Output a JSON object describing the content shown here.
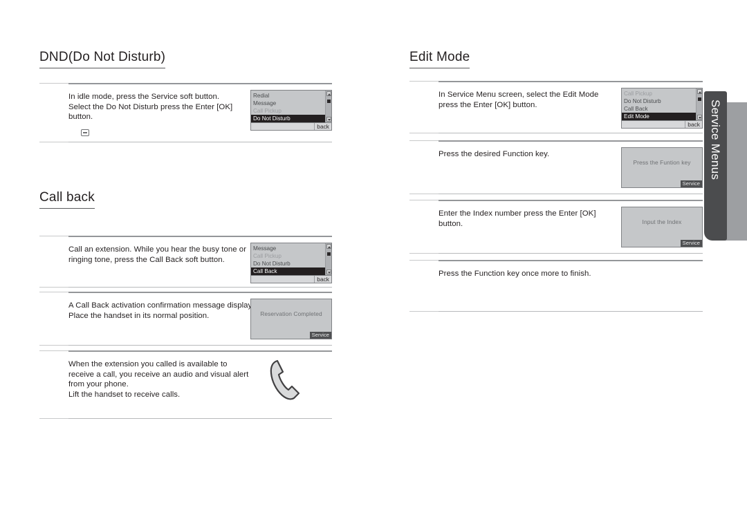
{
  "side_tab": {
    "label": "Service Menus"
  },
  "left_column": {
    "sections": [
      {
        "heading": "DND(Do Not Disturb)",
        "steps": [
          {
            "text": "In idle mode, press the Service  soft button.\nSelect the Do Not Disturb      press the Enter [OK]\nbutton.",
            "key_glyph": "button-key-icon",
            "screen": {
              "type": "list",
              "rows": [
                {
                  "label": "Redial",
                  "state": "normal"
                },
                {
                  "label": "Message",
                  "state": "normal"
                },
                {
                  "label": "Call Pickup",
                  "state": "dim"
                },
                {
                  "label": "Do Not Disturb",
                  "state": "selected"
                }
              ],
              "soft_label": "back"
            }
          }
        ]
      },
      {
        "heading": "Call back",
        "steps": [
          {
            "text": "Call an extension. While you hear the busy tone or\nringing tone, press the Call Back  soft button.",
            "screen": {
              "type": "list",
              "rows": [
                {
                  "label": "Message",
                  "state": "normal"
                },
                {
                  "label": "Call Pickup",
                  "state": "dim"
                },
                {
                  "label": "Do Not Disturb",
                  "state": "normal"
                },
                {
                  "label": "Call Back",
                  "state": "selected"
                }
              ],
              "soft_label": "back"
            }
          },
          {
            "text": "A Call Back activation confirmation message displays.\nPlace the handset in its normal position.",
            "screen": {
              "type": "message",
              "message": "Reservation Completed",
              "soft_label": "Service"
            }
          },
          {
            "text": "When the extension you called is available to\nreceive a call, you receive an audio and visual alert\nfrom your phone.\nLift the handset to receive calls.",
            "screen": {
              "type": "handset-icon"
            }
          }
        ]
      }
    ]
  },
  "right_column": {
    "sections": [
      {
        "heading": "Edit Mode",
        "steps": [
          {
            "text": "In Service Menu screen, select the Edit Mode\npress the Enter [OK] button.",
            "screen": {
              "type": "list",
              "rows": [
                {
                  "label": "Call Pickup",
                  "state": "dim"
                },
                {
                  "label": "Do Not Disturb",
                  "state": "normal"
                },
                {
                  "label": "Call Back",
                  "state": "normal"
                },
                {
                  "label": "Edit Mode",
                  "state": "selected"
                }
              ],
              "soft_label": "back"
            }
          },
          {
            "text": "Press the desired Function  key.",
            "screen": {
              "type": "message",
              "message": "Press the Funtion key",
              "soft_label": "Service"
            }
          },
          {
            "text": "Enter the Index  number      press the Enter [OK]\nbutton.",
            "screen": {
              "type": "message",
              "message": "Input the Index",
              "soft_label": "Service"
            }
          },
          {
            "text": "Press the Function  key once more to finish.",
            "screen": {
              "type": "none"
            }
          }
        ]
      }
    ]
  },
  "colors": {
    "text": "#231f20",
    "rule_light": "#c8c9ca",
    "rule_dark": "#949699",
    "lcd_bg": "#c5c7c9",
    "lcd_border": "#808285",
    "lcd_selected_bg": "#231f20",
    "tab_bg": "#4b4c4e",
    "tab_shadow": "#9d9fa2"
  }
}
